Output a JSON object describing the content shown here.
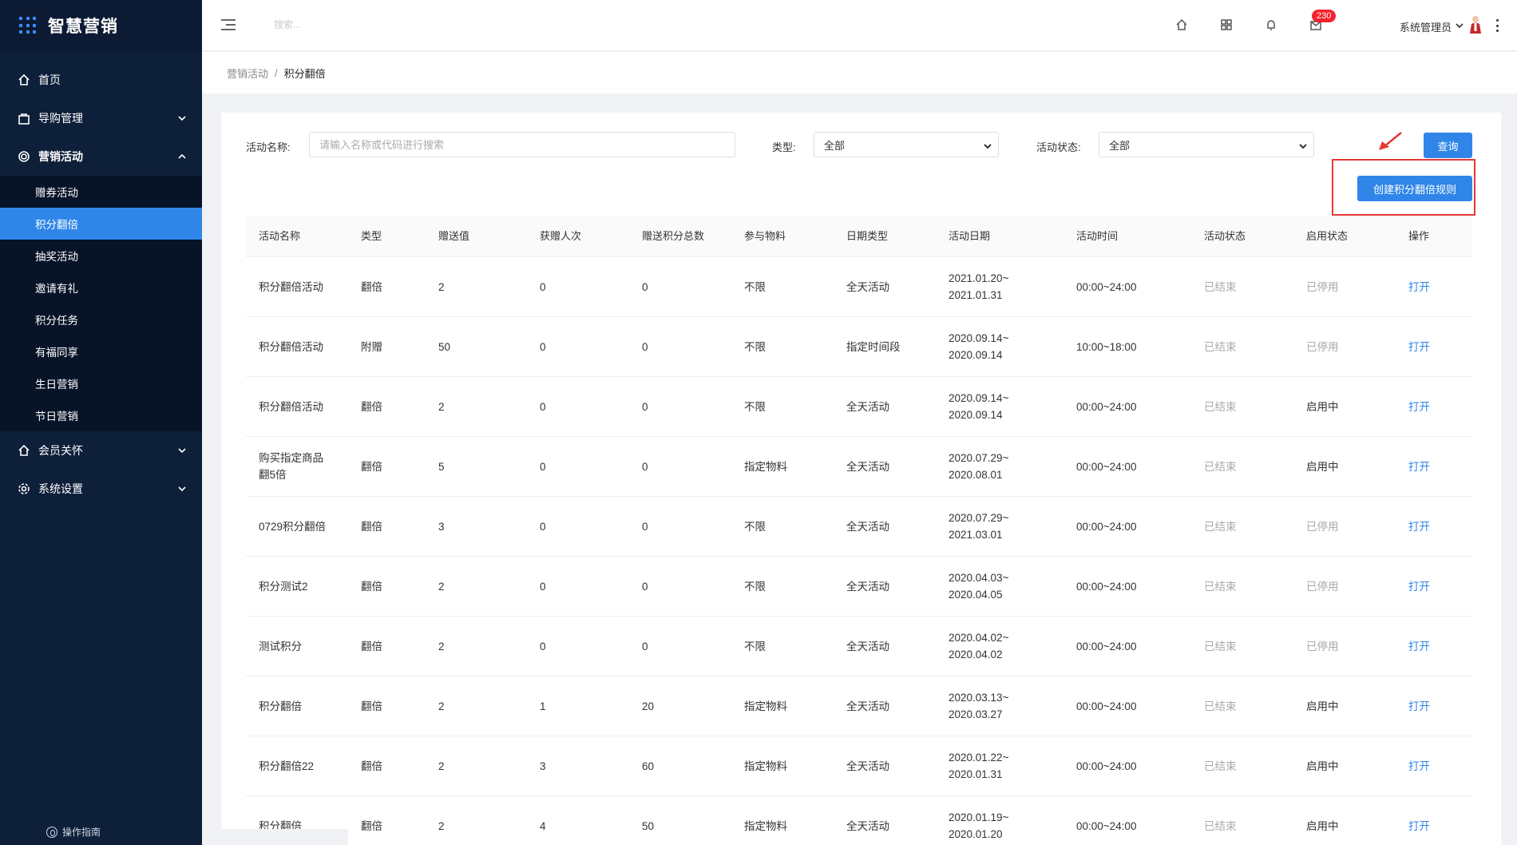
{
  "app": {
    "title": "智慧营销"
  },
  "sidebar": {
    "items": [
      {
        "label": "首页",
        "icon": "home-icon"
      },
      {
        "label": "导购管理",
        "icon": "bag-icon"
      },
      {
        "label": "营销活动",
        "icon": "coins-icon"
      },
      {
        "label": "会员关怀",
        "icon": "home-icon"
      },
      {
        "label": "系统设置",
        "icon": "gear-icon"
      }
    ],
    "submenu": [
      "赠券活动",
      "积分翻倍",
      "抽奖活动",
      "邀请有礼",
      "积分任务",
      "有福同享",
      "生日营销",
      "节日营销"
    ],
    "guide": "操作指南"
  },
  "topbar": {
    "search_placeholder": "搜索...",
    "notification_count": "230",
    "user": "系统管理员"
  },
  "breadcrumb": {
    "parent": "营销活动",
    "sep": "/",
    "current": "积分翻倍"
  },
  "filter": {
    "name_label": "活动名称:",
    "name_placeholder": "请输入名称或代码进行搜索",
    "type_label": "类型:",
    "type_value": "全部",
    "status_label": "活动状态:",
    "status_value": "全部",
    "query_button": "查询",
    "create_button": "创建积分翻倍规则"
  },
  "table": {
    "headers": [
      "活动名称",
      "类型",
      "赠送值",
      "获赠人次",
      "赠送积分总数",
      "参与物料",
      "日期类型",
      "活动日期",
      "活动时间",
      "活动状态",
      "启用状态",
      "操作"
    ],
    "rows": [
      {
        "name": "积分翻倍活动",
        "type": "翻倍",
        "value": "2",
        "count": "0",
        "total": "0",
        "material": "不限",
        "date_type": "全天活动",
        "date1": "2021.01.20~",
        "date2": "2021.01.31",
        "time": "00:00~24:00",
        "status": "已结束",
        "enabled": "已停用",
        "action": "打开"
      },
      {
        "name": "积分翻倍活动",
        "type": "附赠",
        "value": "50",
        "count": "0",
        "total": "0",
        "material": "不限",
        "date_type": "指定时间段",
        "date1": "2020.09.14~",
        "date2": "2020.09.14",
        "time": "10:00~18:00",
        "status": "已结束",
        "enabled": "已停用",
        "action": "打开"
      },
      {
        "name": "积分翻倍活动",
        "type": "翻倍",
        "value": "2",
        "count": "0",
        "total": "0",
        "material": "不限",
        "date_type": "全天活动",
        "date1": "2020.09.14~",
        "date2": "2020.09.14",
        "time": "00:00~24:00",
        "status": "已结束",
        "enabled": "启用中",
        "action": "打开"
      },
      {
        "name": "购买指定商品翻5倍",
        "name1": "购买指定商品",
        "name2": "翻5倍",
        "type": "翻倍",
        "value": "5",
        "count": "0",
        "total": "0",
        "material": "指定物料",
        "date_type": "全天活动",
        "date1": "2020.07.29~",
        "date2": "2020.08.01",
        "time": "00:00~24:00",
        "status": "已结束",
        "enabled": "启用中",
        "action": "打开"
      },
      {
        "name": "0729积分翻倍",
        "type": "翻倍",
        "value": "3",
        "count": "0",
        "total": "0",
        "material": "不限",
        "date_type": "全天活动",
        "date1": "2020.07.29~",
        "date2": "2021.03.01",
        "time": "00:00~24:00",
        "status": "已结束",
        "enabled": "已停用",
        "action": "打开"
      },
      {
        "name": "积分测试2",
        "type": "翻倍",
        "value": "2",
        "count": "0",
        "total": "0",
        "material": "不限",
        "date_type": "全天活动",
        "date1": "2020.04.03~",
        "date2": "2020.04.05",
        "time": "00:00~24:00",
        "status": "已结束",
        "enabled": "已停用",
        "action": "打开"
      },
      {
        "name": "测试积分",
        "type": "翻倍",
        "value": "2",
        "count": "0",
        "total": "0",
        "material": "不限",
        "date_type": "全天活动",
        "date1": "2020.04.02~",
        "date2": "2020.04.02",
        "time": "00:00~24:00",
        "status": "已结束",
        "enabled": "已停用",
        "action": "打开"
      },
      {
        "name": "积分翻倍",
        "type": "翻倍",
        "value": "2",
        "count": "1",
        "total": "20",
        "material": "指定物料",
        "date_type": "全天活动",
        "date1": "2020.03.13~",
        "date2": "2020.03.27",
        "time": "00:00~24:00",
        "status": "已结束",
        "enabled": "启用中",
        "action": "打开"
      },
      {
        "name": "积分翻倍22",
        "type": "翻倍",
        "value": "2",
        "count": "3",
        "total": "60",
        "material": "指定物料",
        "date_type": "全天活动",
        "date1": "2020.01.22~",
        "date2": "2020.01.31",
        "time": "00:00~24:00",
        "status": "已结束",
        "enabled": "启用中",
        "action": "打开"
      },
      {
        "name": "积分翻倍",
        "type": "翻倍",
        "value": "2",
        "count": "4",
        "total": "50",
        "material": "指定物料",
        "date_type": "全天活动",
        "date1": "2020.01.19~",
        "date2": "2020.01.20",
        "time": "00:00~24:00",
        "status": "已结束",
        "enabled": "启用中",
        "action": "打开"
      }
    ]
  },
  "colors": {
    "sidebar": "#0e1f3a",
    "accent": "#2f86e8",
    "highlight": "#e53935",
    "badge": "#f5222d"
  }
}
